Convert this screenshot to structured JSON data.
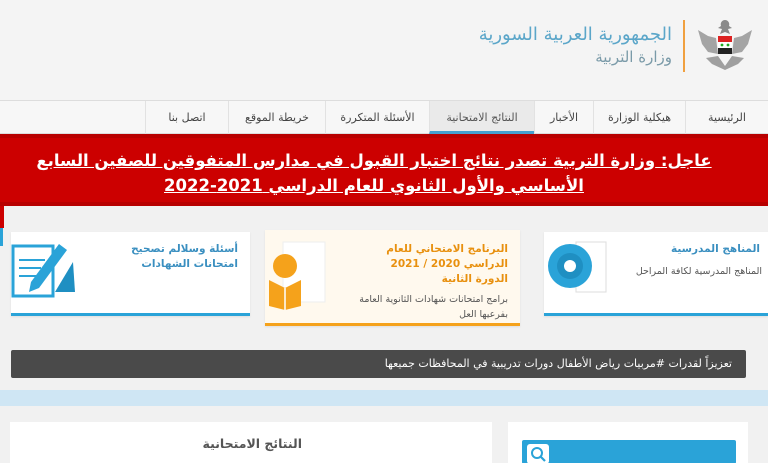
{
  "header": {
    "title": "الجمهورية العربية السورية",
    "subtitle": "وزارة التربية",
    "logo": "syrian-eagle-emblem"
  },
  "nav": {
    "items": [
      {
        "label": "الرئيسية"
      },
      {
        "label": "هيكلية الوزارة"
      },
      {
        "label": "الأخبار"
      },
      {
        "label": "النتائج الامتحانية"
      },
      {
        "label": "الأسئلة المتكررة"
      },
      {
        "label": "خريطة الموقع"
      },
      {
        "label": "اتصل بنا"
      }
    ],
    "active": "النتائج الامتحانية"
  },
  "urgent": {
    "label": "عاجل:",
    "text": "وزارة التربية تصدر نتائج اختبار القبول في مدارس المتفوقين للصفين السابع الأساسي والأول الثانوي للعام الدراسي 2021-2022"
  },
  "cards": [
    {
      "title": "المناهج المدرسية",
      "text": "المناهج المدرسية لكافة المراحل",
      "icon": "disc-icon"
    },
    {
      "title": "البرنامج الامتحاني للعام الدراسي 2020 / 2021 الدورة الثانية",
      "text": "برامج امتحانات شهادات الثانوية العامة بفرعيها العل",
      "icon": "book-reader-icon"
    },
    {
      "title": "أسئلة وسلالم تصحيح امتحانات الشهادات",
      "text": "",
      "icon": "pencil-paper-icon"
    }
  ],
  "ticker": {
    "text": "تعزيزاً لقدرات #مربيات رياض الأطفال دورات تدريبية في المحافظات جميعها"
  },
  "results_panel": {
    "title": "النتائج الامتحانية"
  },
  "search": {
    "icon": "search-icon"
  },
  "colors": {
    "accent_blue": "#2aa3d8",
    "urgent_red": "#cc0000",
    "orange": "#f5a21b"
  }
}
